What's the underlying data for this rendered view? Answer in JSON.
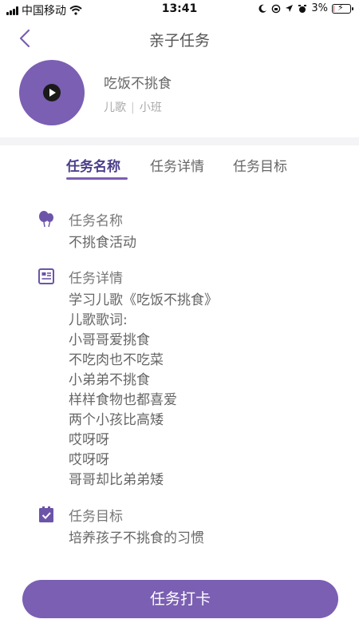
{
  "status_bar": {
    "carrier": "中国移动",
    "time": "13:41",
    "battery_percent": "3%",
    "battery_level": 0.03
  },
  "nav": {
    "title": "亲子任务"
  },
  "song": {
    "title": "吃饭不挑食",
    "category": "儿歌",
    "level": "小班",
    "separator": "|"
  },
  "tabs": [
    {
      "label": "任务名称",
      "active": true
    },
    {
      "label": "任务详情",
      "active": false
    },
    {
      "label": "任务目标",
      "active": false
    }
  ],
  "sections": {
    "name": {
      "label": "任务名称",
      "icon": "balloon-icon",
      "value": "不挑食活动"
    },
    "detail": {
      "label": "任务详情",
      "icon": "document-icon",
      "lines": [
        "学习儿歌《吃饭不挑食》",
        "儿歌歌词:",
        "小哥哥爱挑食",
        "不吃肉也不吃菜",
        "小弟弟不挑食",
        "样样食物也都喜爱",
        "两个小孩比高矮",
        "哎呀呀",
        "哎呀呀",
        "哥哥却比弟弟矮"
      ]
    },
    "goal": {
      "label": "任务目标",
      "icon": "clipboard-check-icon",
      "value": "培养孩子不挑食的习惯"
    }
  },
  "cta": {
    "label": "任务打卡"
  },
  "colors": {
    "accent": "#7b5fb3",
    "accent_dark": "#4a3f8a"
  }
}
